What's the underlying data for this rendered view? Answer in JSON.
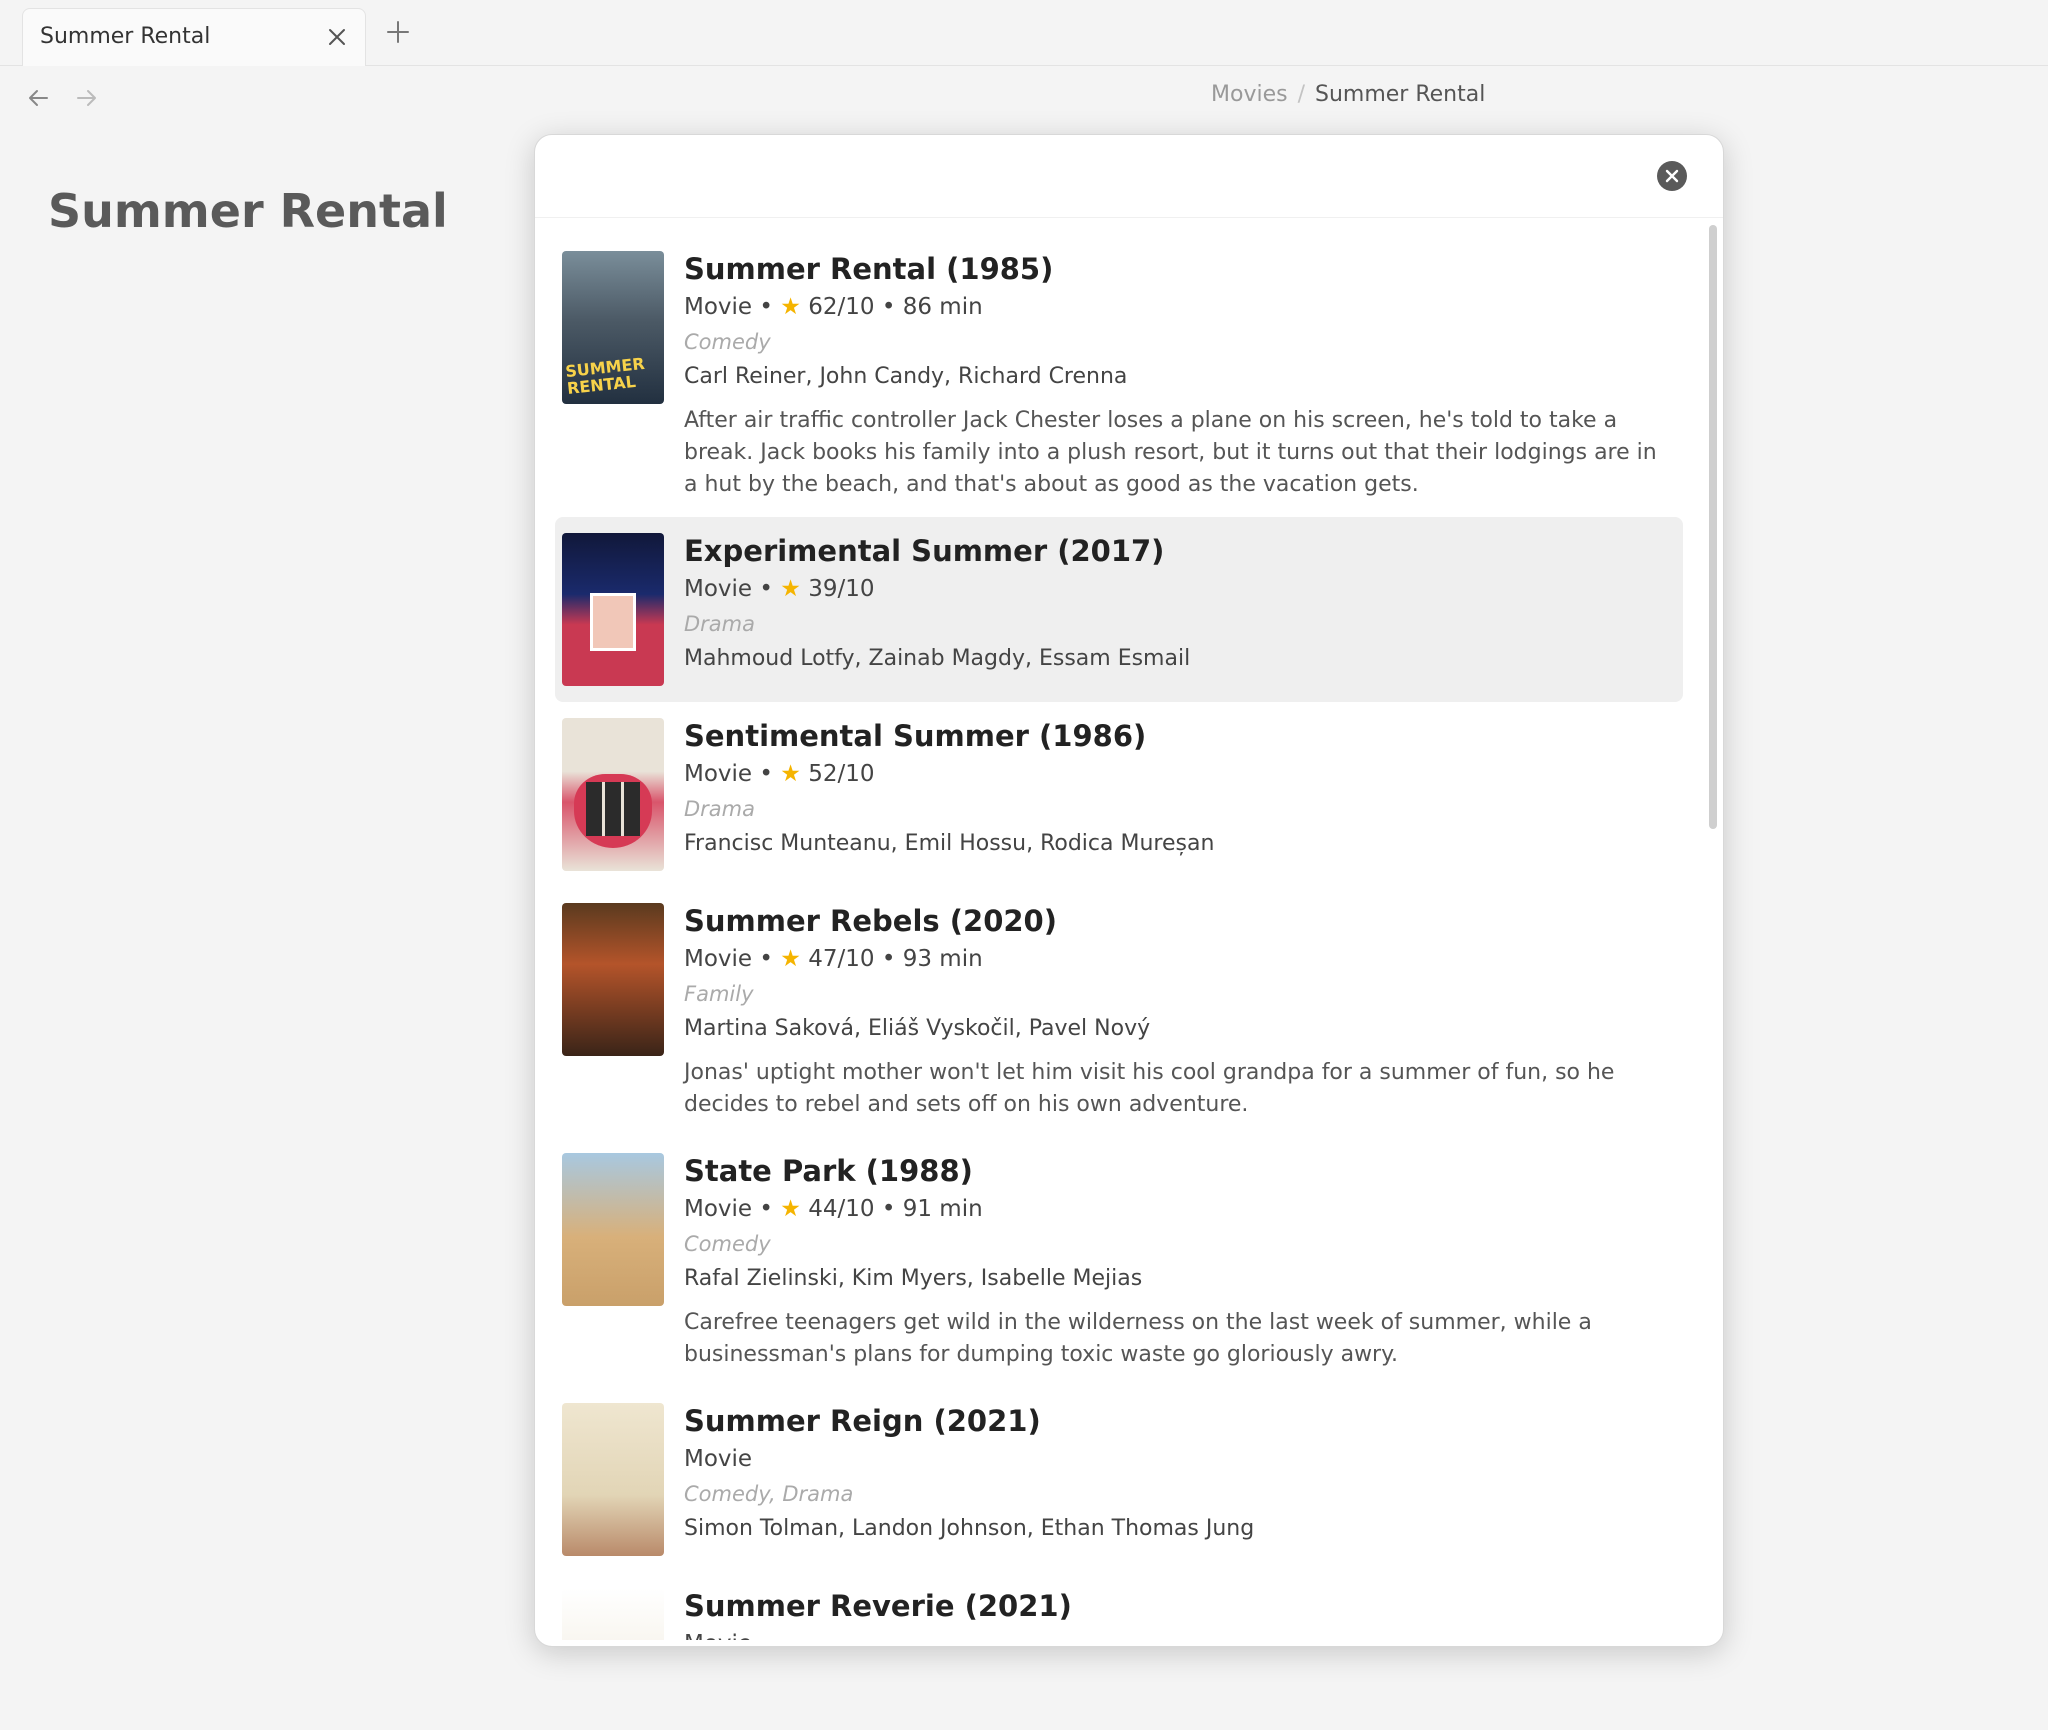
{
  "tab": {
    "title": "Summer Rental"
  },
  "breadcrumb": {
    "parent": "Movies",
    "separator": "/",
    "current": "Summer Rental"
  },
  "page": {
    "title": "Summer Rental"
  },
  "colors": {
    "star": "#f5b400",
    "hover_row": "#efefef",
    "close_button": "#5a5a5a"
  },
  "icons": {
    "tab_close": "close-icon",
    "new_tab": "plus-icon",
    "back": "arrow-left-icon",
    "forward": "arrow-right-icon",
    "modal_close": "close-circle-icon",
    "rating": "star-icon"
  },
  "results": [
    {
      "title": "Summer Rental (1985)",
      "type": "Movie",
      "rating": "62/10",
      "runtime": "86 min",
      "genre": "Comedy",
      "cast": "Carl Reiner, John Candy, Richard Crenna",
      "description": "After air traffic controller Jack Chester loses a plane on his screen, he's told to take a break. Jack books his family into a plush resort, but it turns out that their lodgings are in a hut by the beach, and that's about as good as the vacation gets.",
      "poster_text": "SUMMER RENTAL"
    },
    {
      "title": "Experimental Summer (2017)",
      "type": "Movie",
      "rating": "39/10",
      "genre": "Drama",
      "cast": "Mahmoud Lotfy, Zainab Magdy, Essam Esmail"
    },
    {
      "title": "Sentimental Summer (1986)",
      "type": "Movie",
      "rating": "52/10",
      "genre": "Drama",
      "cast": "Francisc Munteanu, Emil Hossu, Rodica Mureșan"
    },
    {
      "title": "Summer Rebels (2020)",
      "type": "Movie",
      "rating": "47/10",
      "runtime": "93 min",
      "genre": "Family",
      "cast": "Martina Saková, Eliáš Vyskočil, Pavel Nový",
      "description": "Jonas' uptight mother won't let him visit his cool grandpa for a summer of fun, so he decides to rebel and sets off on his own adventure."
    },
    {
      "title": "State Park (1988)",
      "type": "Movie",
      "rating": "44/10",
      "runtime": "91 min",
      "genre": "Comedy",
      "cast": "Rafal Zielinski, Kim Myers, Isabelle Mejias",
      "description": "Carefree teenagers get wild in the wilderness on the last week of summer, while a businessman's plans for dumping toxic waste go gloriously awry."
    },
    {
      "title": "Summer Reign (2021)",
      "type": "Movie",
      "genre": "Comedy, Drama",
      "cast": "Simon Tolman, Landon Johnson, Ethan Thomas Jung"
    },
    {
      "title": "Summer Reverie (2021)",
      "type": "Movie"
    }
  ],
  "meta_separator": "•",
  "star_glyph": "★"
}
